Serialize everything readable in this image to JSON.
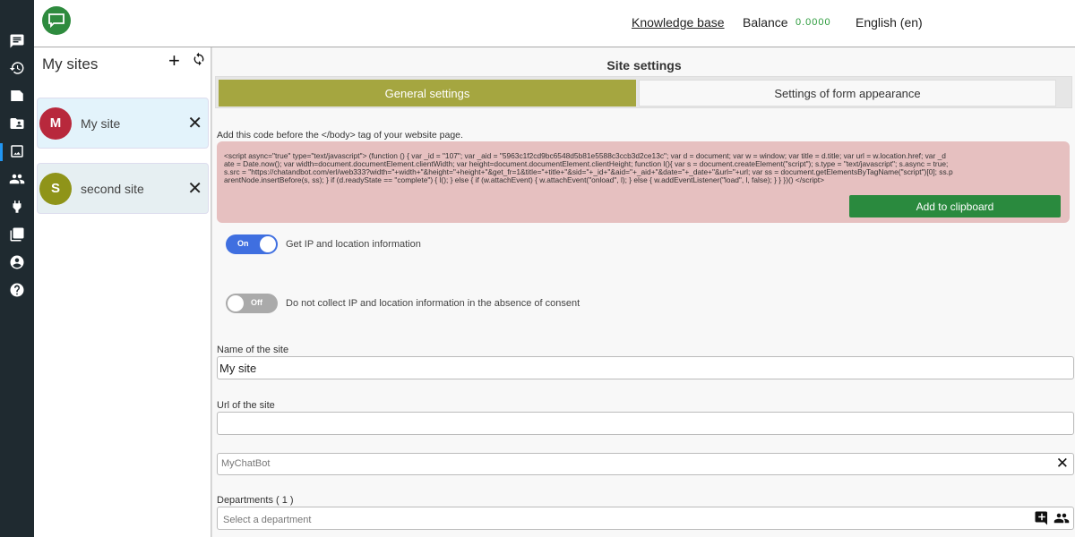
{
  "header": {
    "knowledge_base": "Knowledge base",
    "balance_label": "Balance",
    "balance_value": "0.0000",
    "language": "English (en)"
  },
  "rail": [
    "chat-icon",
    "history-icon",
    "note-icon",
    "folder-user-icon",
    "image-icon",
    "users-icon",
    "plug-icon",
    "pdf-icon",
    "account-icon",
    "help-icon"
  ],
  "sites": {
    "title": "My sites",
    "items": [
      {
        "initial": "M",
        "name": "My site",
        "color": "#b8283c"
      },
      {
        "initial": "S",
        "name": "second site",
        "color": "#8f9419"
      }
    ]
  },
  "main": {
    "title": "Site settings",
    "tabs": [
      {
        "label": "General settings"
      },
      {
        "label": "Settings of form appearance"
      }
    ],
    "hint": "Add this code before the </body> tag of your website page.",
    "code_lines": [
      "<script async=\"true\" type=\"text/javascript\"> (function () { var _id = \"107\"; var _aid = \"5963c1f2cd9bc6548d5b81e5588c3ccb3d2ce13c\"; var d = document; var w = window; var title = d.title; var url = w.location.href; var _d",
      "ate = Date.now(); var width=document.documentElement.clientWidth; var height=document.documentElement.clientHeight; function l(){ var s = document.createElement(\"script\"); s.type = \"text/javascript\"; s.async = true;",
      "s.src = \"https://chatandbot.com/erl/web333?width=\"+width+\"&height=\"+height+\"&get_fr=1&title=\"+title+\"&sid=\"+_id+\"&aid=\"+_aid+\"&date=\"+_date+\"&url=\"+url; var ss = document.getElementsByTagName(\"script\")[0]; ss.p",
      "arentNode.insertBefore(s, ss); } if (d.readyState == \"complete\") { l(); } else { if (w.attachEvent) { w.attachEvent(\"onload\", l); } else { w.addEventListener(\"load\", l, false); } } })() </script>"
    ],
    "copy_label": "Add to clipboard",
    "toggle_ip": {
      "state": "On",
      "label": "Get IP and location information"
    },
    "toggle_consent": {
      "state": "Off",
      "label": "Do not collect IP and location information in the absence of consent"
    },
    "name_label": "Name of the site",
    "name_value": "My site",
    "url_label": "Url of the site",
    "url_value": "",
    "bot_placeholder": "MyChatBot",
    "departments_label": "Departments ( 1 )",
    "department_placeholder": "Select a department"
  }
}
